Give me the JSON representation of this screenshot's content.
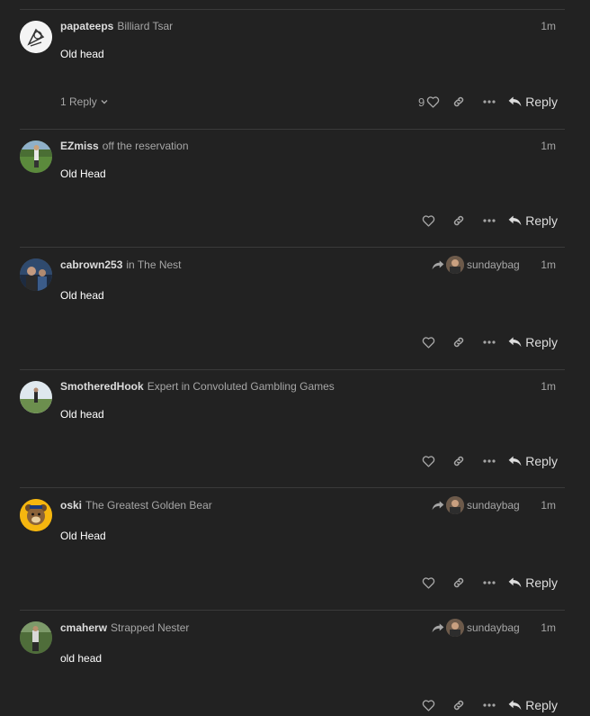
{
  "posts": [
    {
      "username": "papateeps",
      "user_title": "Billiard Tsar",
      "time": "1m",
      "body": "Old head",
      "replies_label": "1 Reply",
      "like_count": "9",
      "reply_label": "Reply",
      "reply_to": null,
      "avatar_icon": "cartoon-avatar"
    },
    {
      "username": "EZmiss",
      "user_title": "off the reservation",
      "time": "1m",
      "body": "Old Head",
      "reply_label": "Reply",
      "reply_to": null,
      "avatar_icon": "golfer-photo-avatar"
    },
    {
      "username": "cabrown253",
      "user_title": "in The Nest",
      "time": "1m",
      "body": "Old head",
      "reply_label": "Reply",
      "reply_to": "sundaybag",
      "avatar_icon": "person-photo-avatar"
    },
    {
      "username": "SmotheredHook",
      "user_title": "Expert in Convoluted Gambling Games",
      "time": "1m",
      "body": "Old head",
      "reply_label": "Reply",
      "reply_to": null,
      "avatar_icon": "golfer-photo-avatar"
    },
    {
      "username": "oski",
      "user_title": "The Greatest Golden Bear",
      "time": "1m",
      "body": "Old Head",
      "reply_label": "Reply",
      "reply_to": "sundaybag",
      "avatar_icon": "bear-mascot-avatar"
    },
    {
      "username": "cmaherw",
      "user_title": "Strapped Nester",
      "time": "1m",
      "body": "old head",
      "reply_label": "Reply",
      "reply_to": "sundaybag",
      "avatar_icon": "golfer-photo-avatar"
    }
  ],
  "colors": {
    "background": "#222222",
    "divider": "#3a3a3a",
    "muted_text": "#a6a6a6",
    "primary_text": "#dddddd"
  }
}
